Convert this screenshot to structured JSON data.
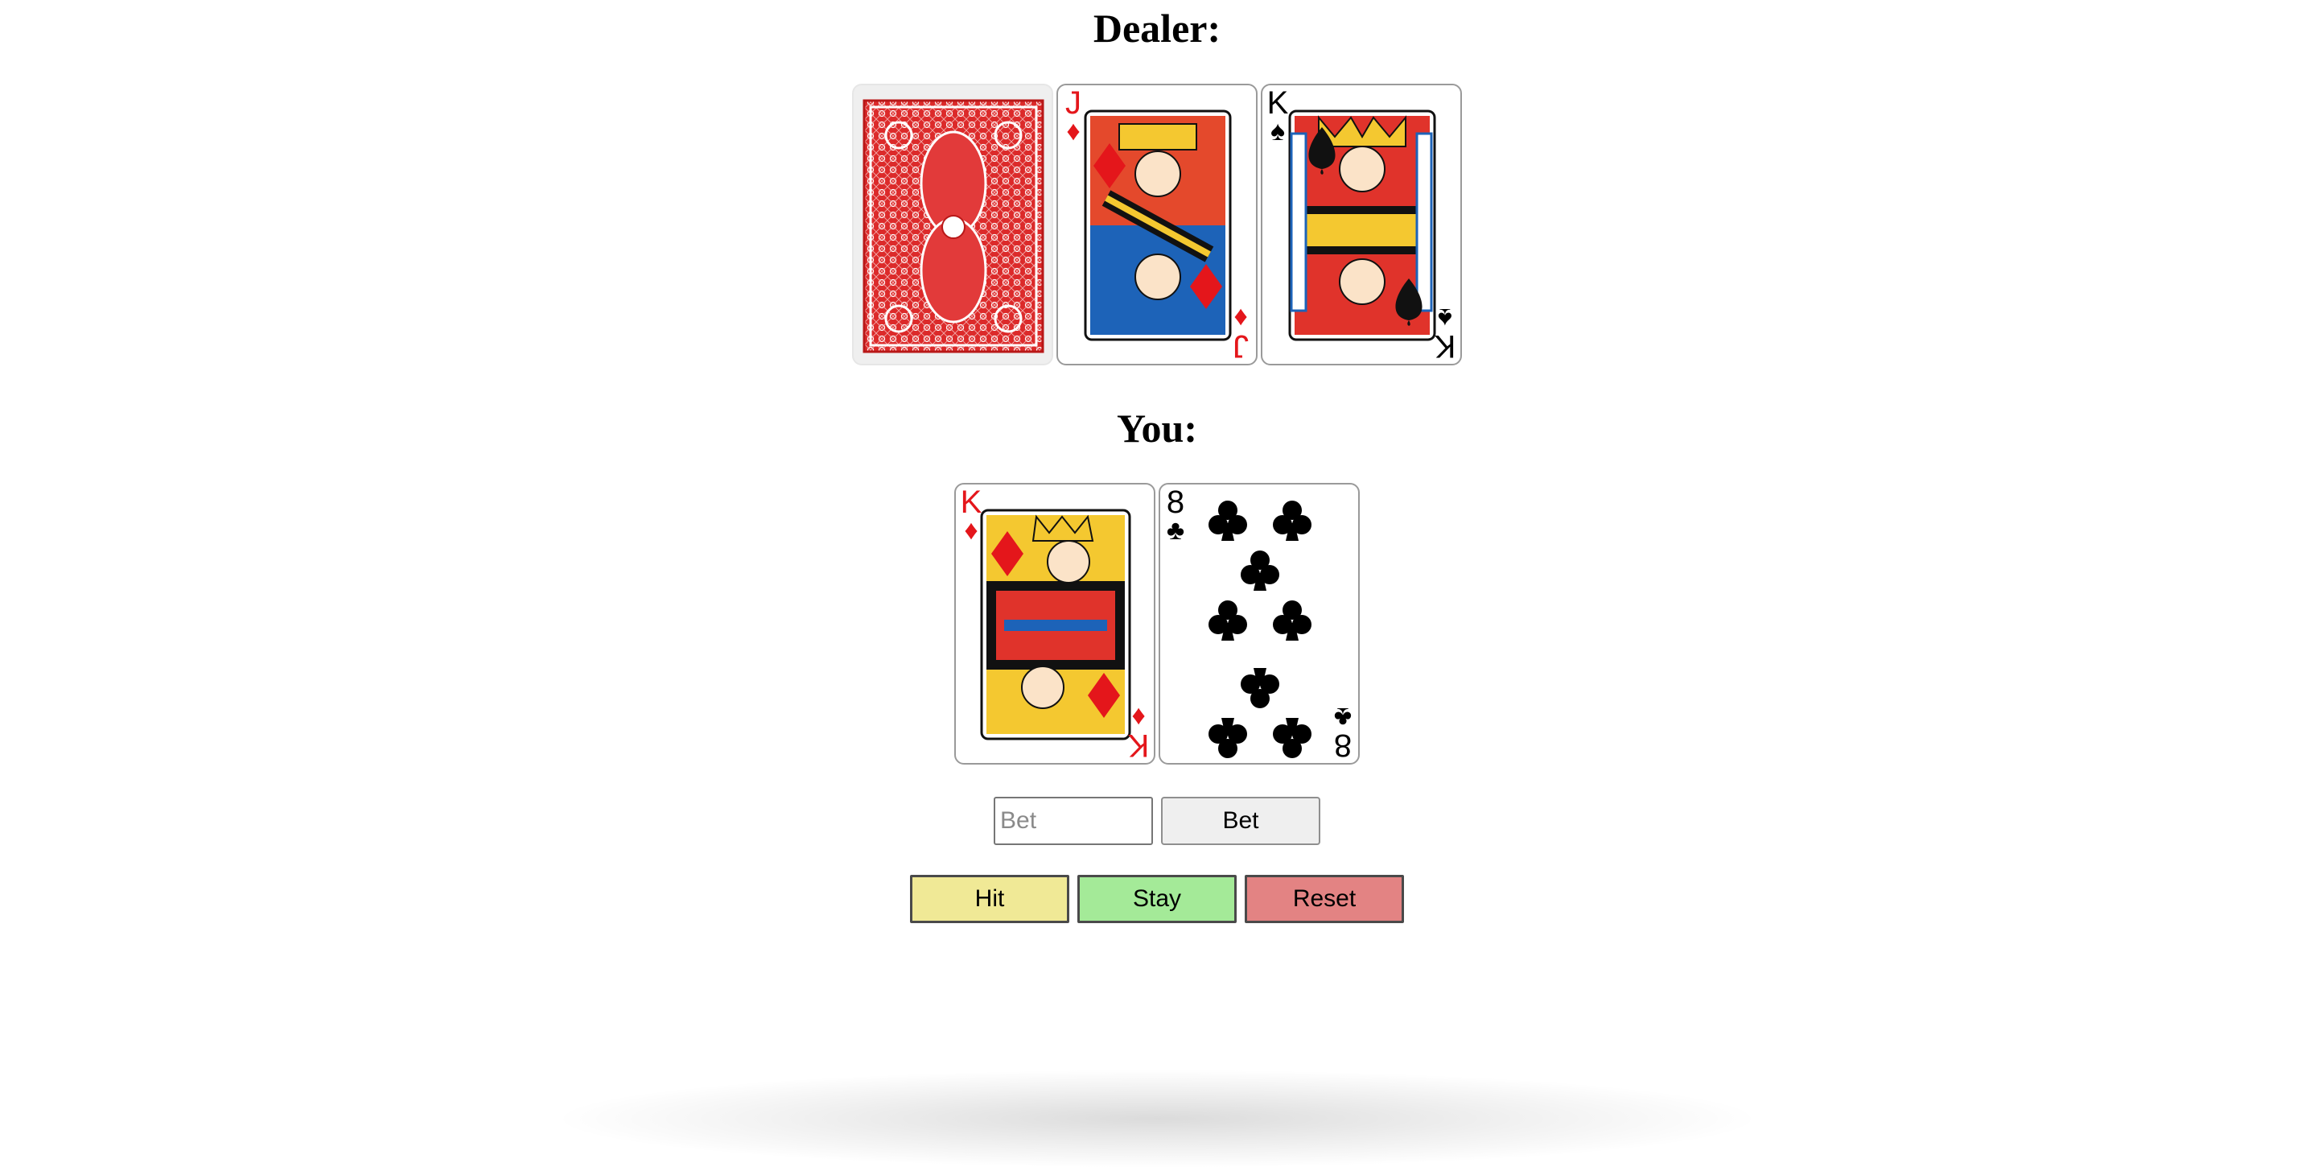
{
  "dealer": {
    "heading": "Dealer:",
    "cards": [
      {
        "face": "back"
      },
      {
        "rank": "J",
        "suit": "♦",
        "suit_name": "diamonds",
        "color": "red"
      },
      {
        "rank": "K",
        "suit": "♠",
        "suit_name": "spades",
        "color": "black"
      }
    ]
  },
  "player": {
    "heading": "You:",
    "cards": [
      {
        "rank": "K",
        "suit": "♦",
        "suit_name": "diamonds",
        "color": "red"
      },
      {
        "rank": "8",
        "suit": "♣",
        "suit_name": "clubs",
        "color": "black"
      }
    ]
  },
  "bet": {
    "input_placeholder": "Bet",
    "input_value": "",
    "button_label": "Bet"
  },
  "actions": {
    "hit_label": "Hit",
    "stay_label": "Stay",
    "reset_label": "Reset"
  },
  "colors": {
    "hit": "#f0e996",
    "stay": "#a4ea98",
    "reset": "#e38383",
    "card_red": "#e4161b",
    "card_back": "#dc2a2a"
  }
}
